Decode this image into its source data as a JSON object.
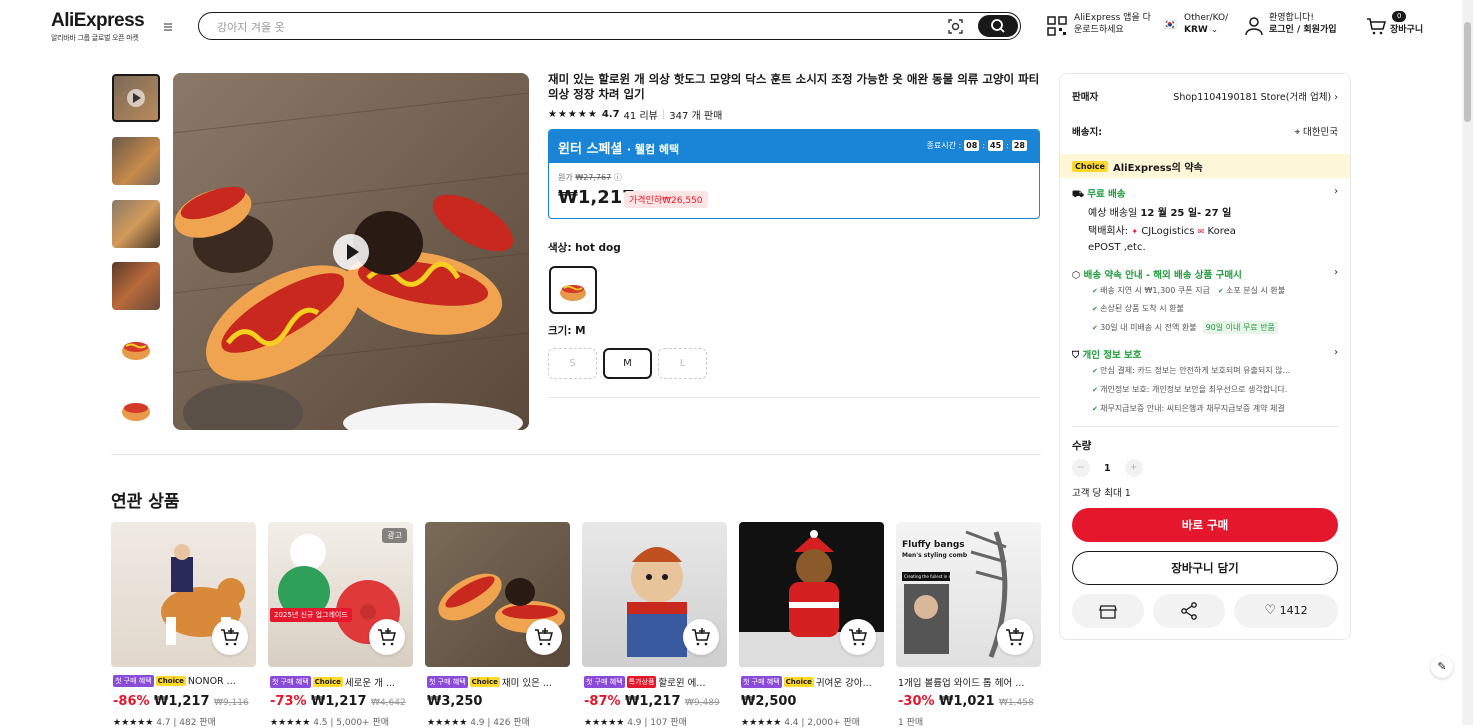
{
  "header": {
    "logo": "AliExpress",
    "logo_tagline": "알리바바 그룹 글로벌 오픈 마켓",
    "search_placeholder": "강아지 겨울 옷",
    "app_line1": "AliExpress 앱을 다",
    "app_line2": "운로드하세요",
    "locale_line1": "Other/KO/",
    "locale_line2": "KRW",
    "account_line1": "환영합니다!",
    "account_line2": "로그인 / 회원가입",
    "cart_count": "0",
    "cart_label": "장바구니"
  },
  "product": {
    "title": "재미 있는 할로윈 개 의상 핫도그 모양의 닥스 훈트 소시지 조정 가능한 옷 애완 동물 의류 고양이 파티 의상 정장 차려 입기",
    "rating": "4.7",
    "reviews": "41 리뷰",
    "sold": "347 개 판매",
    "promo_title": "윈터 스페셜",
    "promo_sub": "· 웰컴 혜택",
    "timer_label": "종료시간 :",
    "timer_h": "08",
    "timer_m": "45",
    "timer_s": "28",
    "orig_label": "원가",
    "orig_price": "₩27,767",
    "price": "₩1,217",
    "discount_pill": "가격인하₩26,550",
    "color_label": "색상: hot dog",
    "size_label": "크기: M",
    "sizes": [
      "S",
      "M",
      "L"
    ]
  },
  "side": {
    "seller_label": "판매자",
    "seller_name": "Shop1104190181 Store(거래 업체)",
    "ship_label": "배송지:",
    "ship_to": "대한민국",
    "choice_tag": "Choice",
    "choice_promise": "AliExpress의 약속",
    "free_ship": "무료 배송",
    "eta_prefix": "예상 배송일",
    "eta": "12 월 25 일- 27 일",
    "courier_label": "택배회사:",
    "courier1": "CJLogistics",
    "courier2": "Korea",
    "courier3": "ePOST ,etc.",
    "promise_title": "배송 약속 안내 - 해외 배송 상품 구매시",
    "promise_items": [
      "배송 지연 시 ₩1,300 쿠폰 지급",
      "소포 분실 시 환불",
      "손상된 상품 도착 시 환불",
      "30일 내 미배송 시 전액 환불"
    ],
    "refund_pill": "90일 이내 무료 반품",
    "privacy_title": "개인 정보 보호",
    "privacy_items": [
      "안심 결제: 카드 정보는 안전하게 보호되며 유출되지 않...",
      "개인정보 보호: 개인정보 보안을 최우선으로 생각합니다.",
      "채무지급보증 안내: 씨티은행과 채무지급보증 계약 체결"
    ],
    "qty_label": "수량",
    "qty": "1",
    "max_label": "고객 당 최대 1",
    "buy_now": "바로 구매",
    "add_cart": "장바구니 담기",
    "wish_count": "1412"
  },
  "related": {
    "title": "연관 상품",
    "items": [
      {
        "badges": [
          "첫 구매 혜택",
          "Choice"
        ],
        "name": "NONOR ...",
        "disc": "-86%",
        "price": "₩1,217",
        "orig": "₩9,116",
        "meta": "4.7 | 482 판매"
      },
      {
        "badges": [
          "첫 구매 혜택",
          "Choice"
        ],
        "name": "세로운 개 ...",
        "disc": "-73%",
        "price": "₩1,217",
        "orig": "₩4,642",
        "meta": "4.5 | 5,000+ 판매",
        "ad": "광고",
        "ribbon": "2025년 신규 업그레이드"
      },
      {
        "badges": [
          "첫 구매 혜택",
          "Choice"
        ],
        "name": "재미 있은 ...",
        "disc": "",
        "price": "₩3,250",
        "orig": "",
        "meta": "4.9 | 426 판매"
      },
      {
        "badges": [
          "첫 구매 혜택",
          "특가상품"
        ],
        "name": "할로윈 에...",
        "disc": "-87%",
        "price": "₩1,217",
        "orig": "₩9,489",
        "meta": "4.9 | 107 판매"
      },
      {
        "badges": [
          "첫 구매 혜택",
          "Choice"
        ],
        "name": "귀여운 강아...",
        "disc": "",
        "price": "₩2,500",
        "orig": "",
        "meta": "4.4 | 2,000+ 판매"
      },
      {
        "badges": [],
        "name": "1개입 볼륨업 와이드 톱 헤어 ...",
        "disc": "-30%",
        "price": "₩1,021",
        "orig": "₩1,458",
        "meta": "1 판매",
        "img_title": "Fluffy bangs",
        "img_sub": "Men's styling comb",
        "img_chip": "Creating the fullest in seconds"
      }
    ]
  },
  "colors": {
    "accent_red": "#e5172c",
    "promo_blue": "#1a85d6",
    "choice_yellow": "#ffd82e",
    "green": "#1f9c3d"
  }
}
